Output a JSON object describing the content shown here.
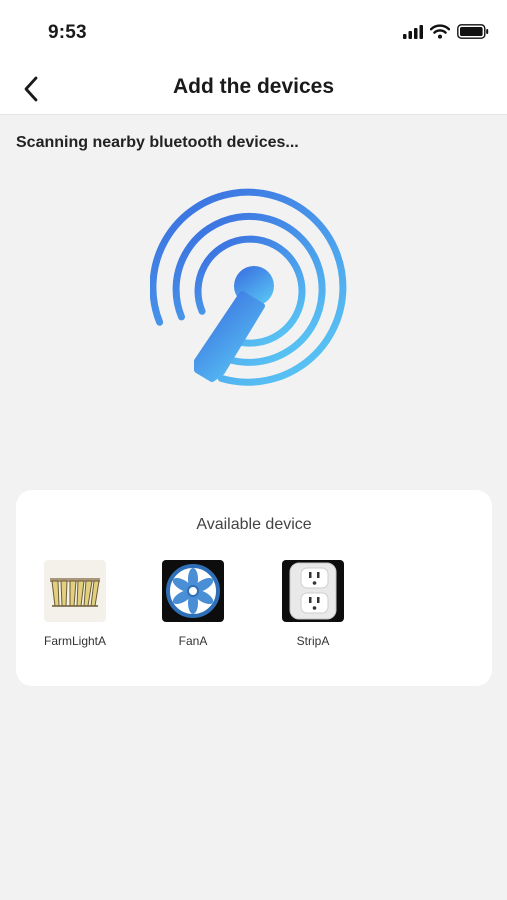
{
  "status": {
    "time": "9:53",
    "icons": [
      "signal-icon",
      "wifi-icon",
      "battery-icon"
    ]
  },
  "nav": {
    "title": "Add the devices",
    "back_icon": "chevron-left-icon"
  },
  "scan": {
    "label": "Scanning nearby bluetooth devices...",
    "icon": "radar-scan-icon",
    "colors": {
      "start": "#3a6fe0",
      "end": "#5ac8f5"
    }
  },
  "available": {
    "title": "Available device",
    "devices": [
      {
        "name": "FarmLightA",
        "icon": "grow-light-icon"
      },
      {
        "name": "FanA",
        "icon": "fan-icon"
      },
      {
        "name": "StripA",
        "icon": "power-strip-icon"
      }
    ]
  }
}
